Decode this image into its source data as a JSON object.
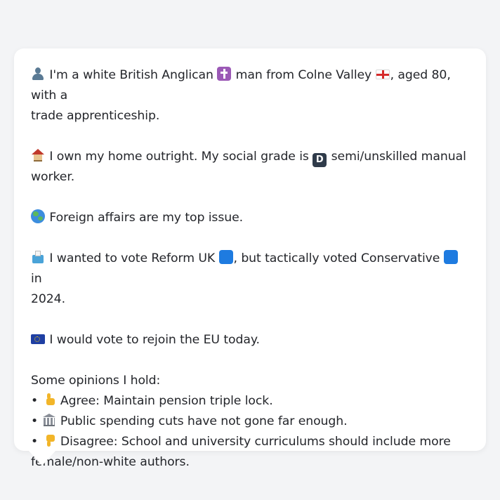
{
  "message": {
    "identity": {
      "icon": "person-silhouette-icon",
      "line1_part1": "I'm a white British Anglican",
      "religion_icon": "latin-cross-icon",
      "line1_part2": "man from Colne Valley",
      "flag_icon": "england-flag-icon",
      "line1_part3": ", aged 80, with a",
      "line2": "trade apprenticeship."
    },
    "home": {
      "icon": "house-icon",
      "line1_part1": "I own my home outright. My social grade is",
      "grade_icon": "letter-d-box-icon",
      "line1_part2": "semi/unskilled manual",
      "line2": "worker."
    },
    "issue": {
      "icon": "globe-icon",
      "text": "Foreign affairs are my top issue."
    },
    "vote": {
      "icon": "ballot-box-icon",
      "line1_part1": "I wanted to vote Reform UK",
      "line1_part2": ", but tactically voted Conservative",
      "line1_part3": "in",
      "line2": "2024.",
      "party_color": "#1e7be0"
    },
    "eu": {
      "icon": "eu-flag-icon",
      "text": "I would vote to rejoin the EU today."
    },
    "opinions": {
      "heading": "Some opinions I hold:",
      "bullet": "•",
      "items": [
        {
          "icon": "thumbs-up-icon",
          "text": "Agree: Maintain pension triple lock."
        },
        {
          "icon": "classical-building-icon",
          "text": "Public spending cuts have not gone far enough."
        },
        {
          "icon": "thumbs-down-icon",
          "line1": "Disagree: School and university curriculums should include more",
          "line2": "female/non-white authors."
        }
      ]
    }
  },
  "colors": {
    "background": "#f3f4f6",
    "bubble": "#ffffff",
    "text": "#24262b"
  }
}
